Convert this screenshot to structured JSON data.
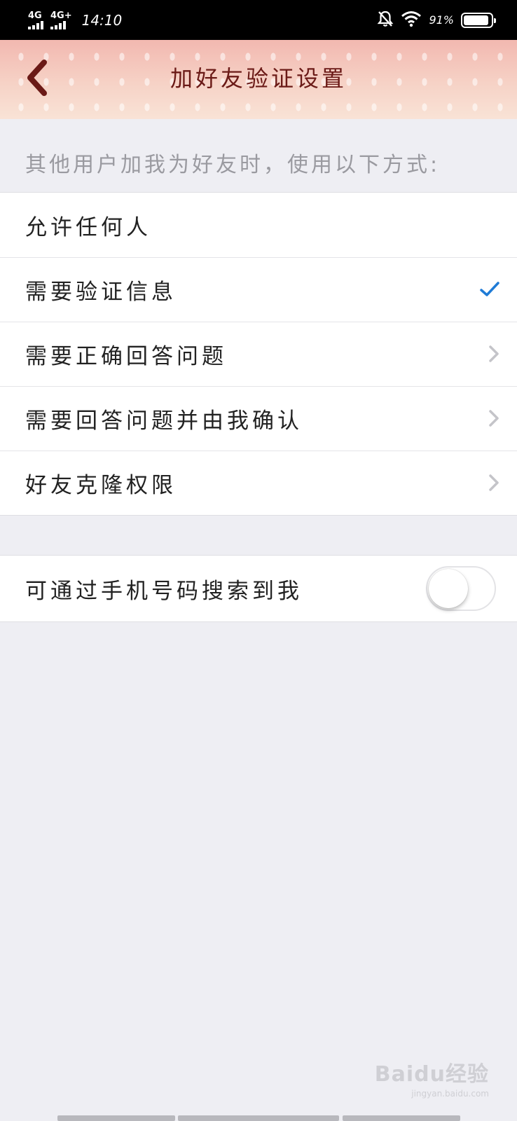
{
  "status_bar": {
    "signal1": "4G",
    "signal2": "4G+",
    "time": "14:10",
    "battery_pct": "91%",
    "battery_level": 0.91,
    "icons": [
      "bell-muted-icon",
      "wifi-icon",
      "battery-icon"
    ]
  },
  "header": {
    "title": "加好友验证设置",
    "back_icon": "chevron-left-icon"
  },
  "section_note": "其他用户加我为好友时，使用以下方式:",
  "options": [
    {
      "label": "允许任何人",
      "indicator": "none"
    },
    {
      "label": "需要验证信息",
      "indicator": "check"
    },
    {
      "label": "需要正确回答问题",
      "indicator": "chevron"
    },
    {
      "label": "需要回答问题并由我确认",
      "indicator": "chevron"
    },
    {
      "label": "好友克隆权限",
      "indicator": "chevron"
    }
  ],
  "phone_search": {
    "label": "可通过手机号码搜索到我",
    "enabled": false
  },
  "watermark": {
    "main": "Baidu经验",
    "url": "jingyan.baidu.com"
  },
  "colors": {
    "accent_check": "#1f7bd6",
    "title_color": "#6b1a17",
    "background": "#eeeef3"
  }
}
